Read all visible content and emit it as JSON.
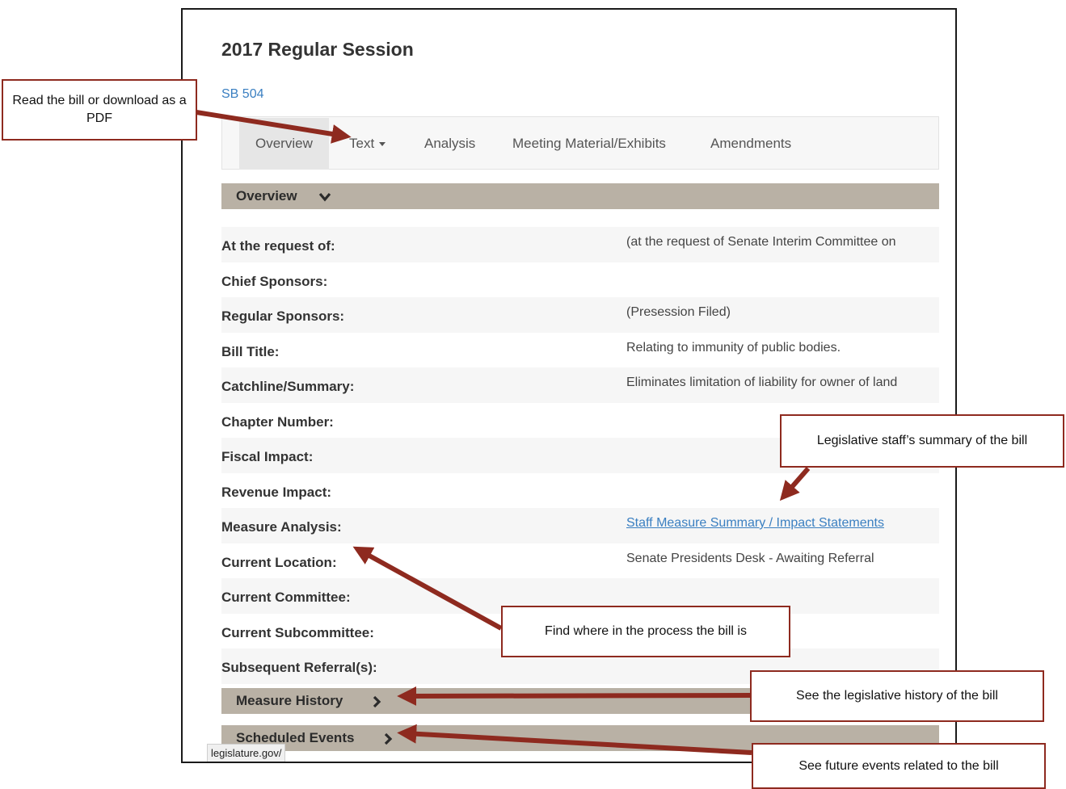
{
  "page": {
    "session_title": "2017 Regular Session",
    "bill_id": "SB 504"
  },
  "tabs": [
    {
      "label": "Overview",
      "active": true
    },
    {
      "label": "Text",
      "dropdown": true
    },
    {
      "label": "Analysis"
    },
    {
      "label": "Meeting Material/Exhibits"
    },
    {
      "label": "Amendments"
    }
  ],
  "overview_section": {
    "label": "Overview",
    "expanded": true
  },
  "fields": [
    {
      "key": "At the request of:",
      "value": "(at the request of Senate Interim Committee on"
    },
    {
      "key": "Chief Sponsors:",
      "value": ""
    },
    {
      "key": "Regular Sponsors:",
      "value": "(Presession Filed)"
    },
    {
      "key": "Bill Title:",
      "value": "Relating to immunity of public bodies."
    },
    {
      "key": "Catchline/Summary:",
      "value": "Eliminates limitation of liability for owner of land"
    },
    {
      "key": "Chapter Number:",
      "value": ""
    },
    {
      "key": "Fiscal Impact:",
      "value": ""
    },
    {
      "key": "Revenue Impact:",
      "value": ""
    },
    {
      "key": "Measure Analysis:",
      "value": "Staff Measure Summary / Impact Statements",
      "is_link": true
    },
    {
      "key": "Current Location:",
      "value": "Senate Presidents Desk - Awaiting Referral"
    },
    {
      "key": "Current Committee:",
      "value": ""
    },
    {
      "key": "Current Subcommittee:",
      "value": ""
    },
    {
      "key": "Subsequent Referral(s):",
      "value": ""
    }
  ],
  "collapsed_sections": [
    {
      "label": "Measure History"
    },
    {
      "label": "Scheduled Events"
    }
  ],
  "status_bar": {
    "url": "legislature.gov/"
  },
  "callouts": {
    "read_bill": "Read the bill or download as a PDF",
    "staff_summary": "Legislative staff’s summary of the bill",
    "process": "Find where in the process the bill is",
    "history": "See the legislative history of the bill",
    "future_events": "See future events related to the bill"
  },
  "colors": {
    "callout_border": "#8e2a1f",
    "arrow": "#8e2a1f",
    "section_bar": "#b9b1a5",
    "link": "#3a7fc1"
  }
}
